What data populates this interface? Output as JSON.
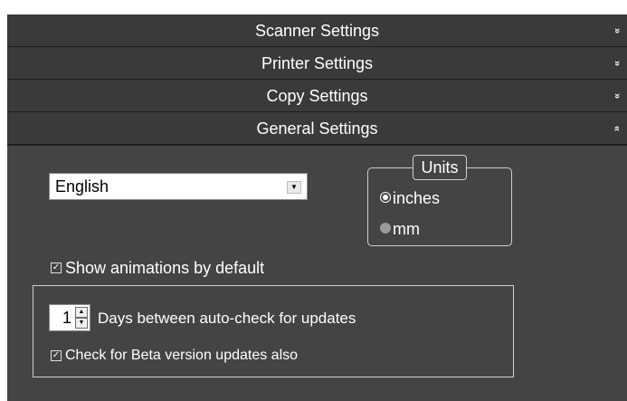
{
  "sections": {
    "scanner": {
      "label": "Scanner Settings",
      "chevron": "»",
      "expanded": false
    },
    "printer": {
      "label": "Printer Settings",
      "chevron": "»",
      "expanded": false
    },
    "copy": {
      "label": "Copy Settings",
      "chevron": "»",
      "expanded": false
    },
    "general": {
      "label": "General Settings",
      "chevron": "»",
      "expanded": true
    }
  },
  "general": {
    "language": {
      "value": "English",
      "arrow": "▼"
    },
    "units": {
      "legend": "Units",
      "options": [
        {
          "label": "inches",
          "selected": true
        },
        {
          "label": "mm",
          "selected": false
        }
      ]
    },
    "show_animations": {
      "label": "Show animations by default",
      "checked": true,
      "mark": "✓"
    },
    "updates": {
      "days_value": "1",
      "days_label": "Days between auto-check for updates",
      "beta": {
        "label": "Check for Beta version updates also",
        "checked": true,
        "mark": "✓"
      }
    }
  },
  "colors": {
    "header_bg": "#3a3a3a",
    "panel_bg": "#444444",
    "text": "#ffffff"
  }
}
